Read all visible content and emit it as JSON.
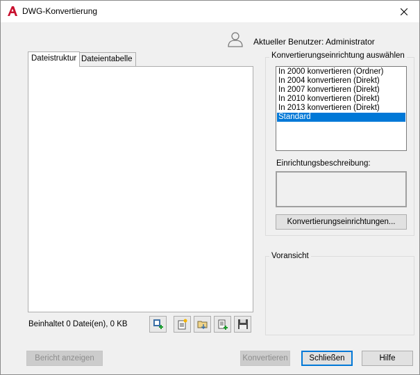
{
  "window": {
    "title": "DWG-Konvertierung"
  },
  "user": {
    "label": "Aktueller Benutzer: Administrator"
  },
  "tabs": [
    {
      "label": "Dateistruktur"
    },
    {
      "label": "Dateientabelle"
    }
  ],
  "file_panel": {
    "status": "Beinhaltet 0 Datei(en), 0 KB"
  },
  "setups_group": {
    "label": "Konvertierungseinrichtung auswählen",
    "items": [
      "In 2000 konvertieren (Ordner)",
      "In 2004 konvertieren (Direkt)",
      "In 2007 konvertieren (Direkt)",
      "In 2010 konvertieren (Direkt)",
      "In 2013 konvertieren (Direkt)",
      "Standard"
    ],
    "selected": "Standard",
    "description_label": "Einrichtungsbeschreibung:",
    "description": "",
    "setups_button": "Konvertierungseinrichtungen..."
  },
  "preview_group": {
    "label": "Voransicht"
  },
  "buttons": {
    "report": "Bericht anzeigen",
    "convert": "Konvertieren",
    "close": "Schließen",
    "help": "Hilfe"
  },
  "colors": {
    "accent": "#0078d7",
    "app_icon": "#c8102e"
  }
}
